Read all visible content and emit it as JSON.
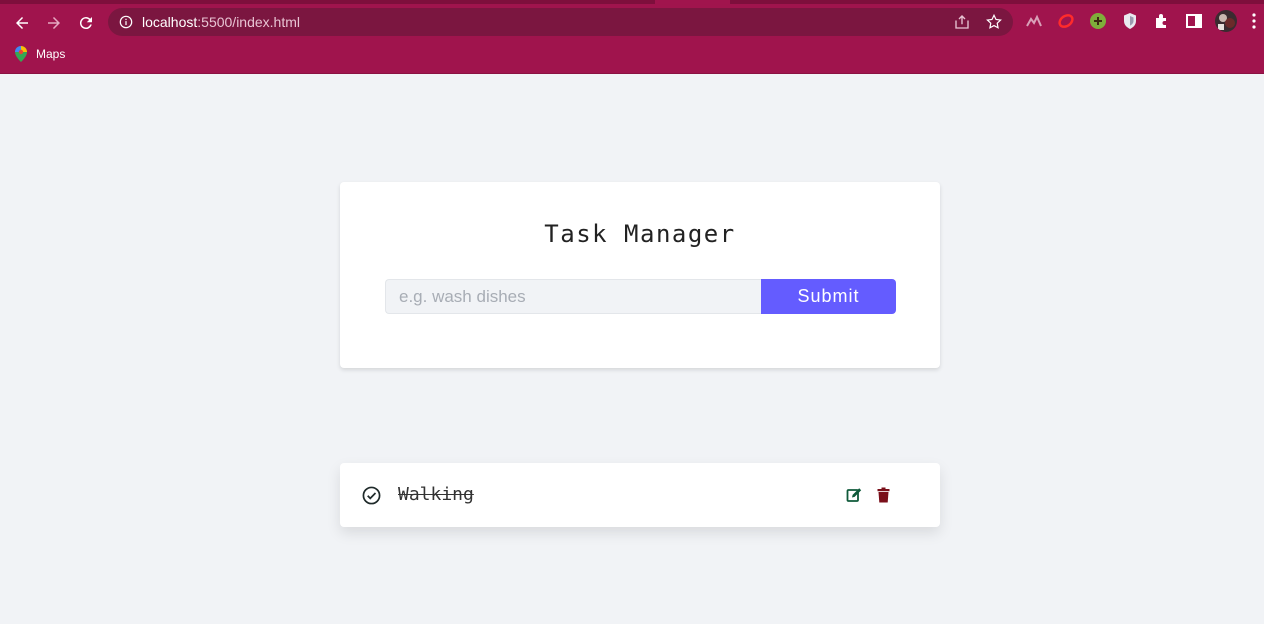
{
  "browser": {
    "url_host": "localhost",
    "url_path": ":5500/index.html",
    "bookmark": "Maps",
    "colors": {
      "frame": "#a0144d",
      "omnibox": "#7b1640"
    }
  },
  "app": {
    "title": "Task Manager",
    "input": {
      "placeholder": "e.g. wash dishes",
      "value": ""
    },
    "submit_label": "Submit",
    "accent": "#645cff"
  },
  "tasks": [
    {
      "name": "Walking",
      "completed": true,
      "icons": [
        "check-circle-icon",
        "edit-icon",
        "trash-icon"
      ]
    }
  ]
}
